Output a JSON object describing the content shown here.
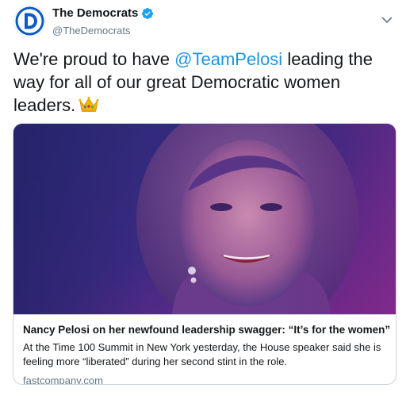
{
  "account": {
    "display_name": "The Democrats",
    "handle": "@TheDemocrats",
    "verified_icon": "verified-badge-icon",
    "avatar_icon": "democrats-d-logo"
  },
  "tweet": {
    "text_before": "We're proud to have ",
    "mention": "@TeamPelosi",
    "text_after": " leading the way for all of our great Democratic women leaders.",
    "emoji": "crown-emoji"
  },
  "card": {
    "title": "Nancy Pelosi on her newfound leadership swagger: “It’s for the women”",
    "description": "At the Time 100 Summit in New York yesterday, the House speaker said she is feeling more “liberated” during her second stint in the role.",
    "domain": "fastcompany.com"
  },
  "colors": {
    "brand_blue": "#0a5bc4",
    "link_blue": "#1b95e0",
    "verified_blue": "#1da1f2",
    "secondary_text": "#657786",
    "image_purple": "#6a2a8c"
  }
}
